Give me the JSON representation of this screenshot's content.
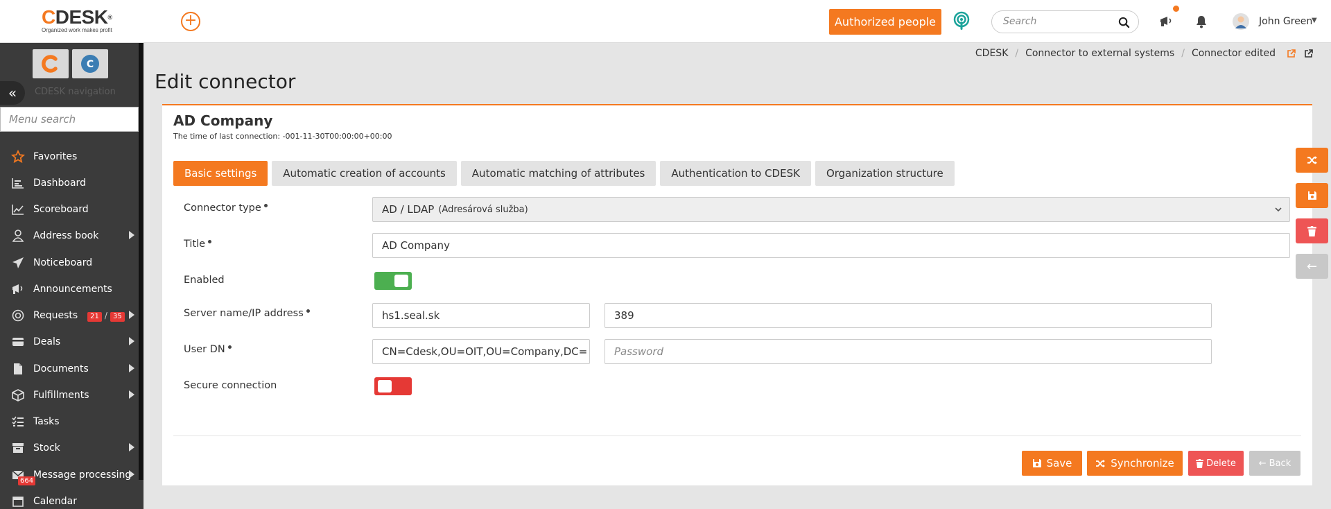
{
  "app": {
    "logo_word_c": "C",
    "logo_word_rest": "DESK",
    "logo_reg": "®",
    "logo_tagline": "Organized work makes profit"
  },
  "header": {
    "authorized_people": "Authorized people",
    "search_placeholder": "Search",
    "user_name": "John Green"
  },
  "sidebar": {
    "nav_title": "CDESK navigation",
    "menu_search_placeholder": "Menu search",
    "app_tile_2_letter": "C",
    "items": [
      {
        "label": "Favorites",
        "icon": "star-icon"
      },
      {
        "label": "Dashboard",
        "icon": "dashboard-icon"
      },
      {
        "label": "Scoreboard",
        "icon": "chart-line-icon"
      },
      {
        "label": "Address book",
        "icon": "user-icon"
      },
      {
        "label": "Noticeboard",
        "icon": "paper-plane-icon"
      },
      {
        "label": "Announcements",
        "icon": "megaphone-icon"
      },
      {
        "label": "Requests",
        "icon": "lifebuoy-icon",
        "badge_a": "21",
        "badge_sep": "/",
        "badge_b": "35"
      },
      {
        "label": "Deals",
        "icon": "card-icon"
      },
      {
        "label": "Documents",
        "icon": "document-icon"
      },
      {
        "label": "Fulfillments",
        "icon": "box-icon"
      },
      {
        "label": "Tasks",
        "icon": "tasks-icon"
      },
      {
        "label": "Stock",
        "icon": "archive-icon"
      },
      {
        "label": "Message processing",
        "icon": "envelope-icon",
        "badge": "664"
      },
      {
        "label": "Calendar",
        "icon": "calendar-icon"
      }
    ]
  },
  "breadcrumb": [
    "CDESK",
    "Connector to external systems",
    "Connector edited"
  ],
  "page": {
    "title": "Edit connector"
  },
  "card": {
    "title": "AD Company",
    "subtitle": "The time of last connection: -001-11-30T00:00:00+00:00"
  },
  "tabs": [
    {
      "label": "Basic settings",
      "active": true
    },
    {
      "label": "Automatic creation of accounts",
      "active": false
    },
    {
      "label": "Automatic matching of attributes",
      "active": false
    },
    {
      "label": "Authentication to CDESK",
      "active": false
    },
    {
      "label": "Organization structure",
      "active": false
    }
  ],
  "form": {
    "connector_type_label": "Connector type",
    "connector_type_value": "AD / LDAP",
    "connector_type_detail": "(Adresárová služba)",
    "title_label": "Title",
    "title_value": "AD Company",
    "enabled_label": "Enabled",
    "enabled": true,
    "server_label": "Server name/IP address",
    "server_value": "hs1.seal.sk",
    "port_value": "389",
    "user_dn_label": "User DN",
    "user_dn_value": "CN=Cdesk,OU=OIT,OU=Company,DC=",
    "password_placeholder": "Password",
    "secure_label": "Secure connection",
    "secure": false
  },
  "actions": {
    "save": "Save",
    "synchronize": "Synchronize",
    "delete": "Delete",
    "back": "Back"
  },
  "colors": {
    "accent": "#f47920",
    "success": "#4caf50",
    "danger": "#e53935",
    "muted": "#c8c8c8",
    "sidebar": "#3b3b3b"
  }
}
